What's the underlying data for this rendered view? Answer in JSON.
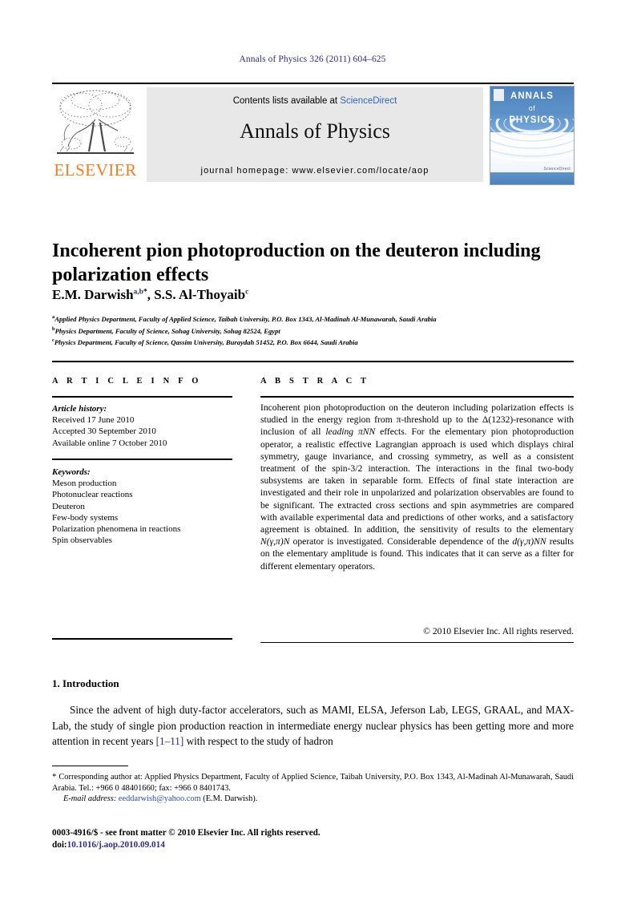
{
  "running_head": "Annals of Physics 326 (2011) 604–625",
  "masthead": {
    "contents_prefix": "Contents lists available at ",
    "sciencedirect": "ScienceDirect",
    "journal_name": "Annals of Physics",
    "homepage": "journal homepage: www.elsevier.com/locate/aop",
    "publisher_name": "ELSEVIER",
    "cover": {
      "line1": "ANNALS",
      "line2": "of",
      "line3": "PHYSICS",
      "sciencedirect_mark": "ScienceDirect"
    },
    "accent_blue": "#2f63b8",
    "elsevier_orange": "#f07c1f"
  },
  "article": {
    "title": "Incoherent pion photoproduction on the deuteron including polarization effects",
    "authors_prefix": "E.M. Darwish",
    "author1_sup": "a,b",
    "author1_star": "*",
    "authors_mid": ", S.S. Al-Thoyaib",
    "author2_sup": "c",
    "affiliations": [
      {
        "marker": "a",
        "text": "Applied Physics Department, Faculty of Applied Science, Taibah University, P.O. Box 1343, Al-Madinah Al-Munawarah, Saudi Arabia"
      },
      {
        "marker": "b",
        "text": "Physics Department, Faculty of Science, Sohag University, Sohag 82524, Egypt"
      },
      {
        "marker": "c",
        "text": "Physics Department, Faculty of Science, Qassim University, Buraydah 51452, P.O. Box 6644, Saudi Arabia"
      }
    ]
  },
  "info": {
    "heading": "A R T I C L E    I N F O",
    "history_label": "Article history:",
    "history": [
      "Received 17 June 2010",
      "Accepted 30 September 2010",
      "Available online 7 October 2010"
    ],
    "keywords_label": "Keywords:",
    "keywords": [
      "Meson production",
      "Photonuclear reactions",
      "Deuteron",
      "Few-body systems",
      "Polarization phenomena in reactions",
      "Spin observables"
    ]
  },
  "abstract": {
    "heading": "A B S T R A C T",
    "part1": "Incoherent pion photoproduction on the deuteron including polarization effects is studied in the energy region from π-threshold up to the Δ(1232)-resonance with inclusion of all ",
    "italic1": "leading πNN",
    "part2": " effects. For the elementary pion photoproduction operator, a realistic effective Lagrangian approach is used which displays chiral symmetry, gauge invariance, and crossing symmetry, as well as a consistent treatment of the spin-3/2 interaction. The interactions in the final two-body subsystems are taken in separable form. Effects of final state interaction are investigated and their role in unpolarized and polarization observables are found to be significant. The extracted cross sections and spin asymmetries are compared with available experimental data and predictions of other works, and a satisfactory agreement is obtained. In addition, the sensitivity of results to the elementary ",
    "italic2": "N(γ,π)N",
    "part3": " operator is investigated. Considerable dependence of the ",
    "italic3": "d(γ,π)NN",
    "part4": " results on the elementary amplitude is found. This indicates that it can serve as a filter for different elementary operators.",
    "copyright": "© 2010 Elsevier Inc. All rights reserved."
  },
  "introduction": {
    "section_number_title": "1. Introduction",
    "paragraph_part1": "Since the advent of high duty-factor accelerators, such as MAMI, ELSA, Jeferson Lab, LEGS, GRAAL, and MAX-Lab, the study of single pion production reaction in intermediate energy nuclear physics has been getting more and more attention in recent years ",
    "reference": "[1–11]",
    "paragraph_part2": " with respect to the study of hadron"
  },
  "footer": {
    "corresponding_star": "*",
    "corresponding_note": " Corresponding author at: Applied Physics Department, Faculty of Applied Science, Taibah University, P.O. Box 1343, Al-Madinah Al-Munawarah, Saudi Arabia. Tel.: +966 0 48401660; fax: +966 0 8401743.",
    "email_label": "E-mail address:",
    "email": "eeddarwish@yahoo.com",
    "email_owner": " (E.M. Darwish).",
    "issn_line": "0003-4916/$ - see front matter © 2010 Elsevier Inc. All rights reserved.",
    "doi_label": "doi:",
    "doi": "10.1016/j.aop.2010.09.014"
  }
}
